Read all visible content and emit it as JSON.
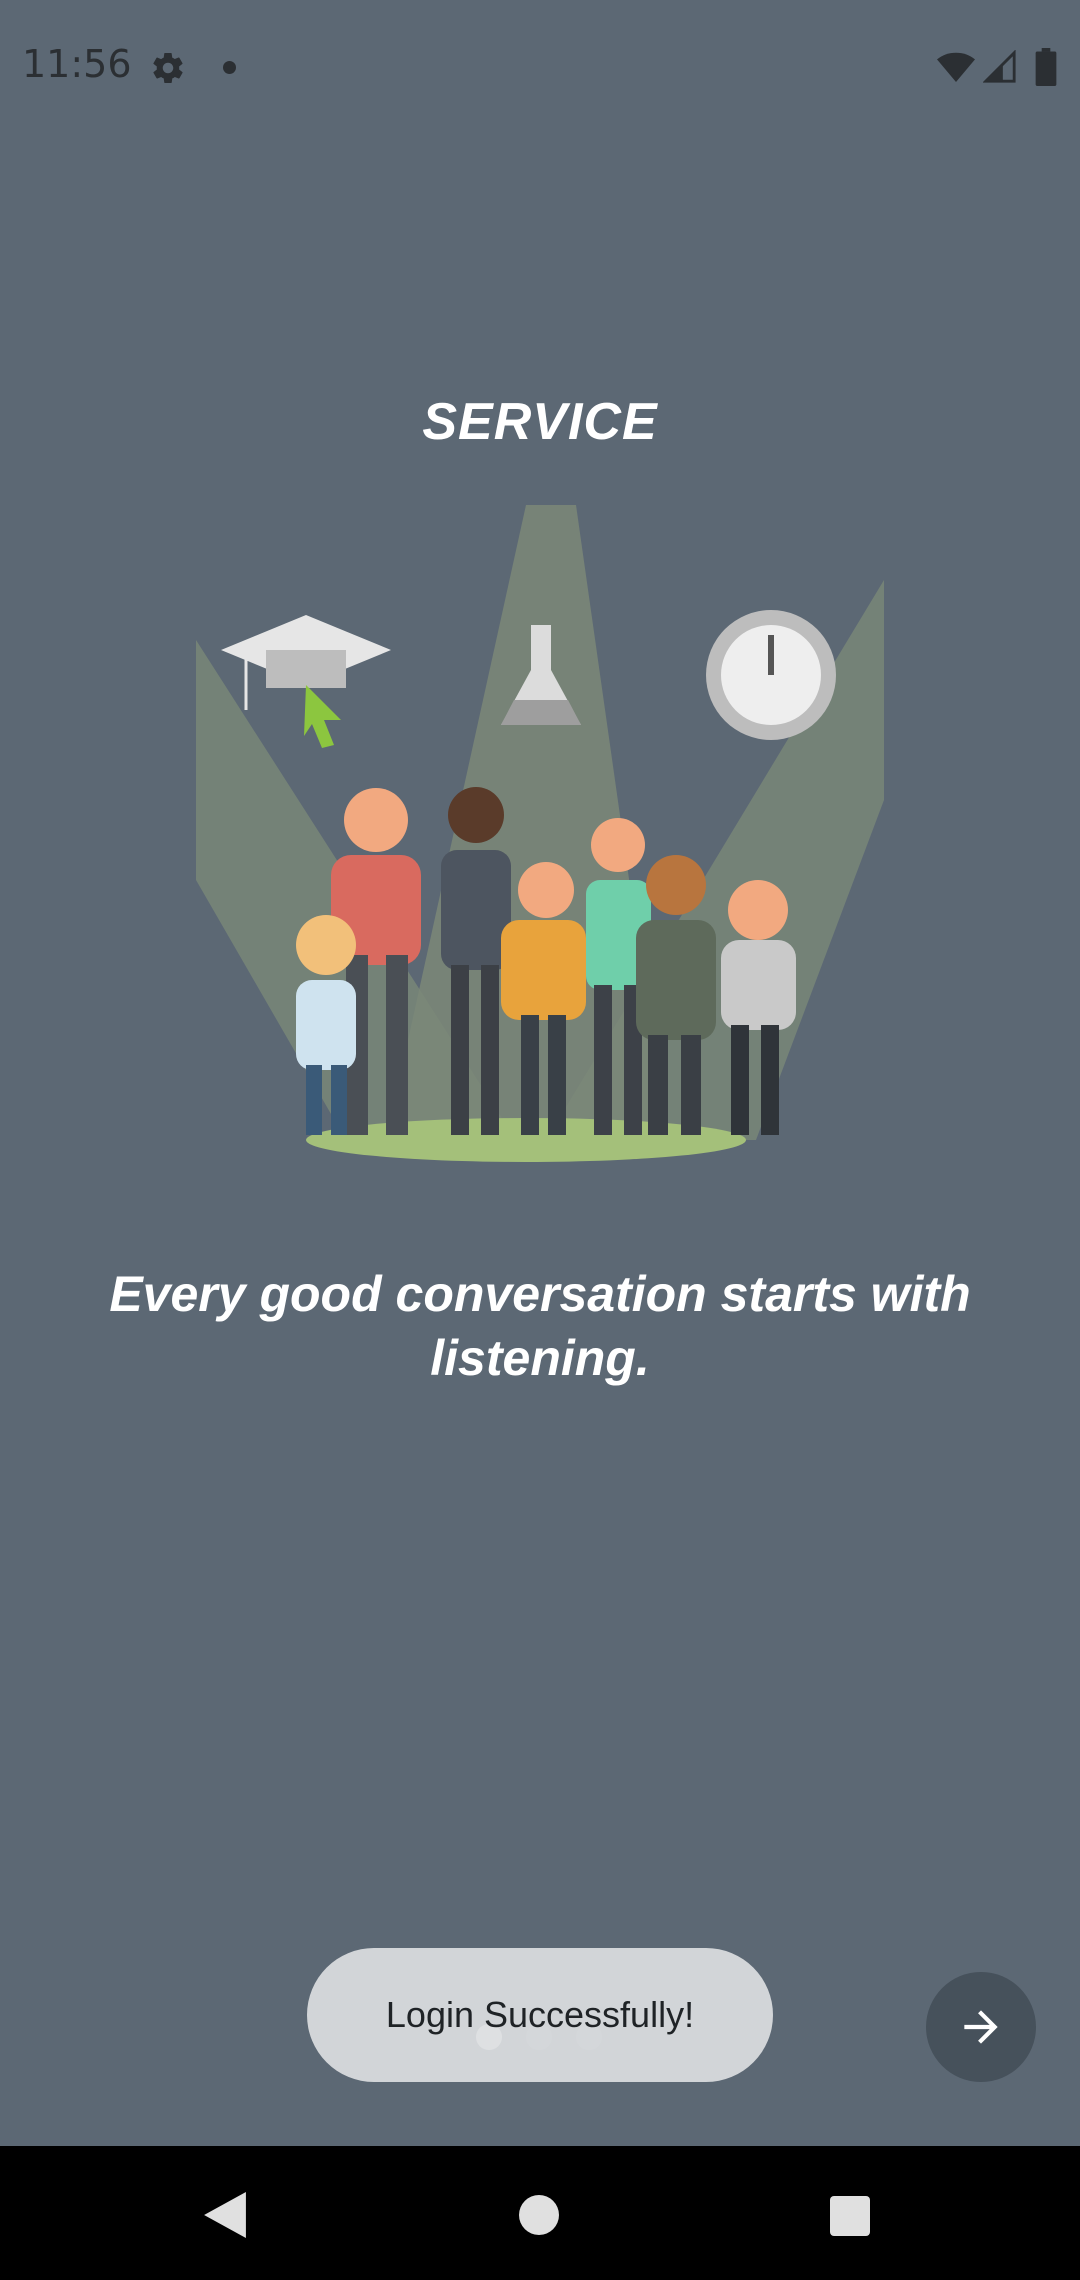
{
  "status_bar": {
    "time": "11:56",
    "icons": [
      "gear-icon",
      "notification-dot-icon",
      "wifi-icon",
      "signal-icon",
      "battery-icon"
    ]
  },
  "onboarding": {
    "title": "SERVICE",
    "illustration": "people-under-spotlights-illustration",
    "tagline": "Every good conversation starts with listening.",
    "page_count": 3,
    "current_page": 1
  },
  "toast": {
    "message": "Login Successfully!"
  },
  "next_button": {
    "icon": "arrow-right-icon"
  },
  "navigation_bar": {
    "buttons": [
      "back-icon",
      "home-icon",
      "recents-icon"
    ]
  },
  "colors": {
    "background": "#5c6874",
    "text": "#ffffff",
    "toast_bg": "#dcdee0",
    "next_button_bg": "#46515b"
  }
}
